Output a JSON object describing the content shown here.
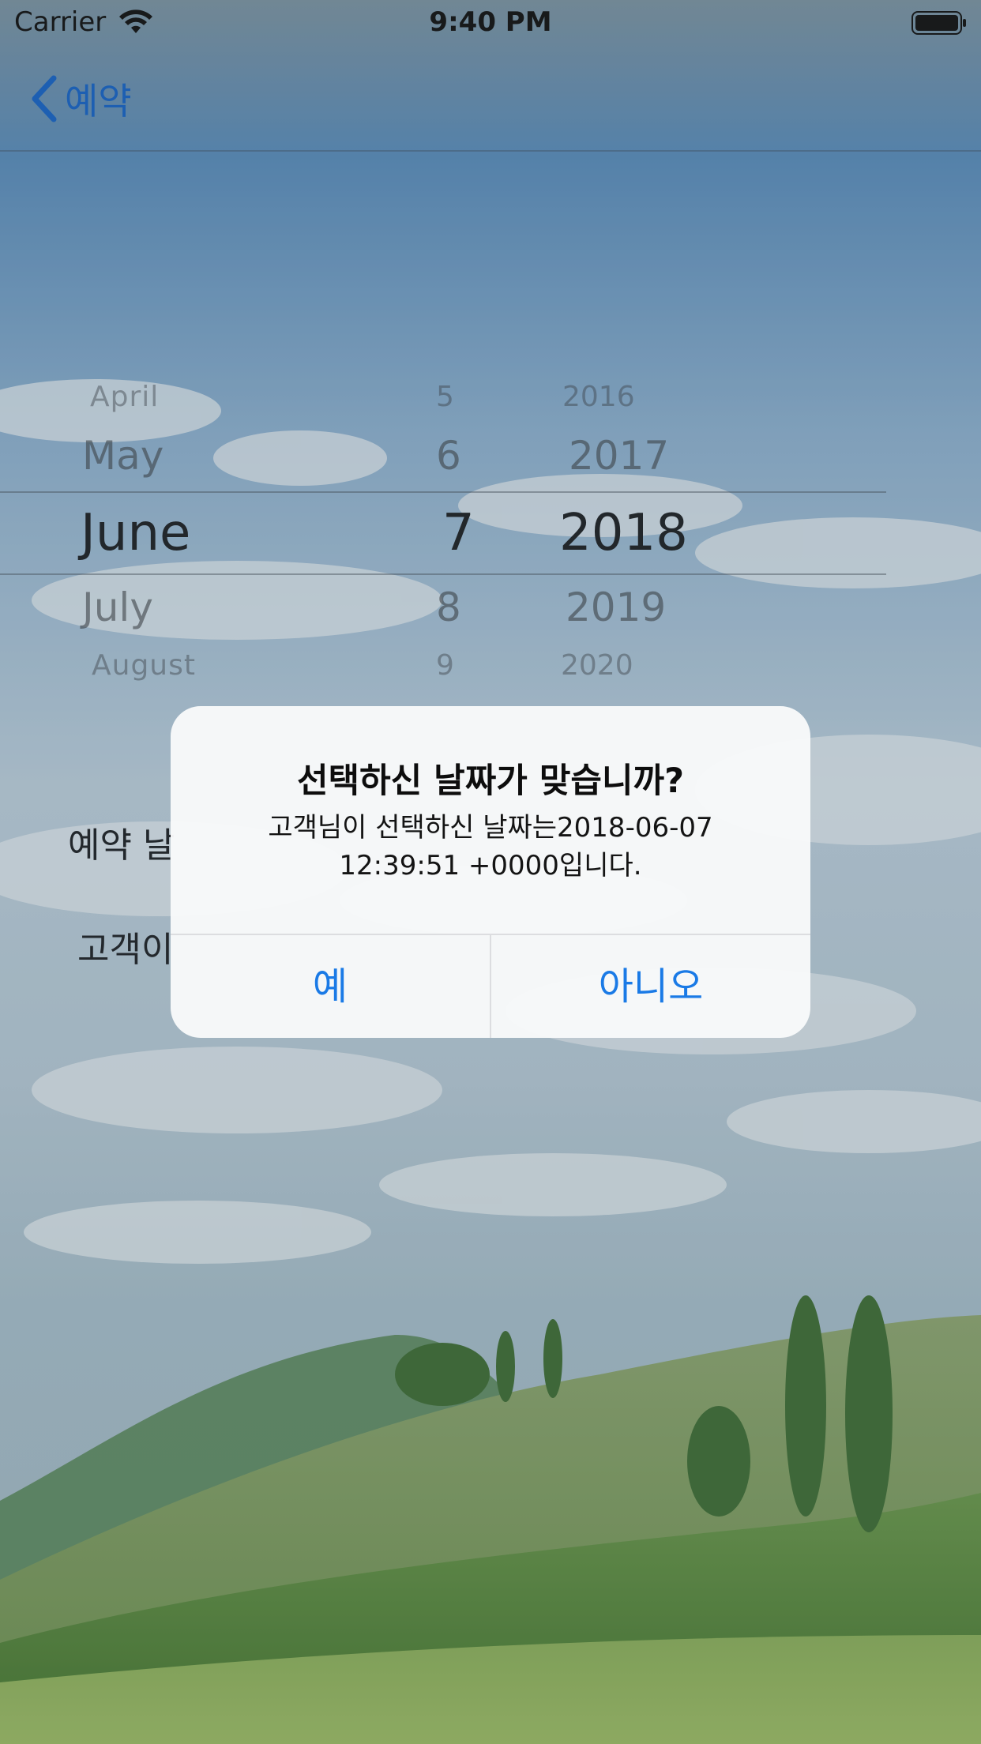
{
  "status_bar": {
    "carrier": "Carrier",
    "time": "9:40 PM"
  },
  "nav": {
    "back_label": "예약"
  },
  "picker": {
    "months": [
      "April",
      "May",
      "June",
      "July",
      "August"
    ],
    "days": [
      "5",
      "6",
      "7",
      "8",
      "9"
    ],
    "years": [
      "2016",
      "2017",
      "2018",
      "2019",
      "2020"
    ],
    "selected_index": 2
  },
  "form": {
    "date_label": "예약 날",
    "customer_label": "고객이"
  },
  "alert": {
    "title": "선택하신 날짜가 맞습니까?",
    "message_line1": "고객님이 선택하신 날짜는2018-06-07",
    "message_line2": "12:39:51 +0000입니다.",
    "yes_label": "예",
    "no_label": "아니오"
  },
  "colors": {
    "accent": "#1a7ae6",
    "nav_tint": "#1764c8"
  }
}
